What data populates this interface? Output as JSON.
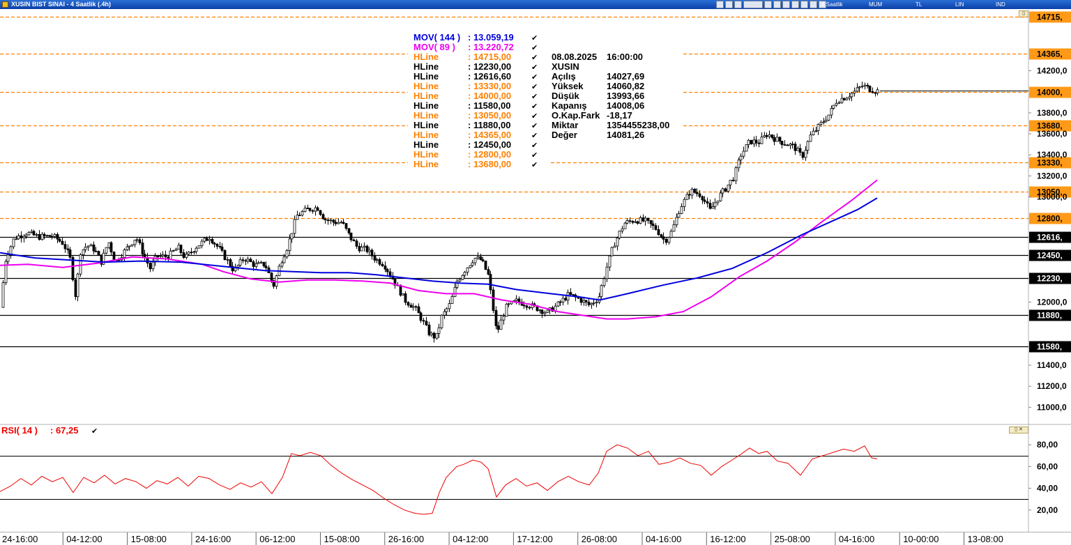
{
  "window": {
    "title": "XUSIN BIST SINAI - 4 Saatlik (.4h)",
    "toolbar": [
      "4 Saatlik",
      "MUM",
      "TL",
      "LIN",
      "IND"
    ]
  },
  "colors": {
    "candle": "#000000",
    "mov144": "#0000dd",
    "mov89": "#ee00ee",
    "hline_black": "#000000",
    "hline_orange": "#ff8000",
    "rsi": "#ee0000",
    "label_orange_bg": "#ff9a18",
    "label_black_bg": "#000000"
  },
  "legend": {
    "items": [
      {
        "name": "MOV( 144 )",
        "value": ": 13.059,19",
        "color": "#0000dd"
      },
      {
        "name": "MOV( 89 )",
        "value": ": 13.220,72",
        "color": "#ee00ee"
      },
      {
        "name": "HLine",
        "value": ": 14715,00",
        "color": "#ff8000"
      },
      {
        "name": "HLine",
        "value": ": 12230,00",
        "color": "#000000"
      },
      {
        "name": "HLine",
        "value": ": 12616,60",
        "color": "#000000"
      },
      {
        "name": "HLine",
        "value": ": 13330,00",
        "color": "#ff8000"
      },
      {
        "name": "HLine",
        "value": ": 14000,00",
        "color": "#ff8000"
      },
      {
        "name": "HLine",
        "value": ": 11580,00",
        "color": "#000000"
      },
      {
        "name": "HLine",
        "value": ": 13050,00",
        "color": "#ff8000"
      },
      {
        "name": "HLine",
        "value": ": 11880,00",
        "color": "#000000"
      },
      {
        "name": "HLine",
        "value": ": 14365,00",
        "color": "#ff8000"
      },
      {
        "name": "HLine",
        "value": ": 12450,00",
        "color": "#000000"
      },
      {
        "name": "HLine",
        "value": ": 12800,00",
        "color": "#ff8000"
      },
      {
        "name": "HLine",
        "value": ": 13680,00",
        "color": "#ff8000"
      }
    ],
    "check_mark": "✔"
  },
  "info": {
    "date": "08.08.2025",
    "time": "16:00:00",
    "symbol": "XUSIN",
    "rows": [
      {
        "label": "Açılış",
        "value": "14027,69"
      },
      {
        "label": "Yüksek",
        "value": "14060,82"
      },
      {
        "label": "Düşük",
        "value": "13993,66"
      },
      {
        "label": "Kapanış",
        "value": "14008,06"
      },
      {
        "label": "O.Kap.Fark",
        "value": "-18,17"
      },
      {
        "label": "Miktar",
        "value": "1354455238,00"
      },
      {
        "label": "Değer",
        "value": "14081,26"
      }
    ]
  },
  "rsi": {
    "label": "RSI( 14 )",
    "value": ": 67,25",
    "ticks": [
      {
        "v": 80,
        "label": "80,00"
      },
      {
        "v": 60,
        "label": "60,00"
      },
      {
        "v": 40,
        "label": "40,00"
      },
      {
        "v": 20,
        "label": "20,00"
      }
    ],
    "levels": [
      70,
      30
    ],
    "points": [
      [
        0,
        37
      ],
      [
        15,
        42
      ],
      [
        30,
        49
      ],
      [
        45,
        43
      ],
      [
        60,
        51
      ],
      [
        75,
        46
      ],
      [
        90,
        50
      ],
      [
        105,
        36
      ],
      [
        120,
        50
      ],
      [
        135,
        45
      ],
      [
        150,
        52
      ],
      [
        165,
        44
      ],
      [
        180,
        49
      ],
      [
        195,
        46
      ],
      [
        210,
        40
      ],
      [
        225,
        47
      ],
      [
        240,
        44
      ],
      [
        255,
        50
      ],
      [
        270,
        42
      ],
      [
        285,
        51
      ],
      [
        300,
        49
      ],
      [
        315,
        43
      ],
      [
        330,
        39
      ],
      [
        345,
        45
      ],
      [
        360,
        41
      ],
      [
        375,
        46
      ],
      [
        390,
        35
      ],
      [
        405,
        50
      ],
      [
        418,
        72
      ],
      [
        430,
        70
      ],
      [
        445,
        73
      ],
      [
        460,
        70
      ],
      [
        475,
        61
      ],
      [
        490,
        54
      ],
      [
        505,
        48
      ],
      [
        520,
        43
      ],
      [
        535,
        38
      ],
      [
        550,
        31
      ],
      [
        565,
        25
      ],
      [
        580,
        20
      ],
      [
        595,
        17
      ],
      [
        608,
        16
      ],
      [
        620,
        17
      ],
      [
        630,
        36
      ],
      [
        640,
        50
      ],
      [
        655,
        60
      ],
      [
        665,
        62
      ],
      [
        678,
        66
      ],
      [
        690,
        64
      ],
      [
        700,
        58
      ],
      [
        712,
        32
      ],
      [
        725,
        43
      ],
      [
        740,
        49
      ],
      [
        755,
        42
      ],
      [
        770,
        45
      ],
      [
        785,
        38
      ],
      [
        800,
        46
      ],
      [
        815,
        51
      ],
      [
        830,
        46
      ],
      [
        845,
        43
      ],
      [
        858,
        54
      ],
      [
        870,
        74
      ],
      [
        885,
        80
      ],
      [
        900,
        77
      ],
      [
        915,
        70
      ],
      [
        930,
        74
      ],
      [
        945,
        62
      ],
      [
        960,
        64
      ],
      [
        975,
        68
      ],
      [
        990,
        63
      ],
      [
        1005,
        61
      ],
      [
        1020,
        52
      ],
      [
        1035,
        60
      ],
      [
        1050,
        66
      ],
      [
        1062,
        71
      ],
      [
        1075,
        77
      ],
      [
        1088,
        72
      ],
      [
        1100,
        74
      ],
      [
        1115,
        65
      ],
      [
        1130,
        63
      ],
      [
        1148,
        52
      ],
      [
        1165,
        67
      ],
      [
        1180,
        70
      ],
      [
        1195,
        73
      ],
      [
        1210,
        76
      ],
      [
        1225,
        74
      ],
      [
        1240,
        79
      ],
      [
        1250,
        68
      ],
      [
        1258,
        67
      ]
    ]
  },
  "chart_data": [
    {
      "type": "candlestick",
      "y_axis": {
        "range": [
          10850,
          14780
        ],
        "ticks": [
          {
            "v": 14200,
            "label": "14200,0"
          },
          {
            "v": 13800,
            "label": "13800,0"
          },
          {
            "v": 13600,
            "label": "13600,0"
          },
          {
            "v": 13400,
            "label": "13400,0"
          },
          {
            "v": 13200,
            "label": "13200,0"
          },
          {
            "v": 13000,
            "label": "13000,0"
          },
          {
            "v": 12000,
            "label": "12000,0"
          },
          {
            "v": 11400,
            "label": "11400,0"
          },
          {
            "v": 11200,
            "label": "11200,0"
          },
          {
            "v": 11000,
            "label": "11000,0"
          }
        ]
      },
      "x_axis": {
        "ticks": [
          "24-16:00",
          "04-12:00",
          "15-08:00",
          "24-16:00",
          "06-12:00",
          "15-08:00",
          "26-16:00",
          "04-12:00",
          "17-12:00",
          "26-08:00",
          "04-16:00",
          "16-12:00",
          "25-08:00",
          "04-16:00",
          "10-00:00",
          "13-08:00"
        ]
      },
      "hlines": [
        {
          "value": 14715,
          "label": "14715,",
          "style": "dashed",
          "color": "orange"
        },
        {
          "value": 14365,
          "label": "14365,",
          "style": "dashed",
          "color": "orange"
        },
        {
          "value": 14000,
          "label": "14000,",
          "style": "dashed",
          "color": "orange"
        },
        {
          "value": 13680,
          "label": "13680,",
          "style": "dashed",
          "color": "orange"
        },
        {
          "value": 13330,
          "label": "13330,",
          "style": "dashed",
          "color": "orange"
        },
        {
          "value": 13050,
          "label": "13050,",
          "style": "dashed",
          "color": "orange"
        },
        {
          "value": 12800,
          "label": "12800,",
          "style": "dashed",
          "color": "orange"
        },
        {
          "value": 12616.6,
          "label": "12616,",
          "style": "solid",
          "color": "black"
        },
        {
          "value": 12450,
          "label": "12450,",
          "style": "solid",
          "color": "black"
        },
        {
          "value": 12230,
          "label": "12230,",
          "style": "solid",
          "color": "black"
        },
        {
          "value": 11880,
          "label": "11880,",
          "style": "solid",
          "color": "black"
        },
        {
          "value": 11580,
          "label": "11580,",
          "style": "solid",
          "color": "black"
        }
      ],
      "close_path": [
        [
          0,
          11950
        ],
        [
          8,
          12420
        ],
        [
          20,
          12610
        ],
        [
          38,
          12660
        ],
        [
          55,
          12620
        ],
        [
          75,
          12630
        ],
        [
          90,
          12560
        ],
        [
          100,
          12420
        ],
        [
          108,
          12050
        ],
        [
          115,
          12480
        ],
        [
          125,
          12540
        ],
        [
          135,
          12500
        ],
        [
          145,
          12380
        ],
        [
          155,
          12580
        ],
        [
          165,
          12380
        ],
        [
          180,
          12500
        ],
        [
          195,
          12620
        ],
        [
          205,
          12460
        ],
        [
          215,
          12320
        ],
        [
          225,
          12440
        ],
        [
          240,
          12430
        ],
        [
          255,
          12520
        ],
        [
          265,
          12420
        ],
        [
          280,
          12520
        ],
        [
          300,
          12620
        ],
        [
          315,
          12500
        ],
        [
          325,
          12400
        ],
        [
          335,
          12300
        ],
        [
          350,
          12420
        ],
        [
          365,
          12350
        ],
        [
          380,
          12360
        ],
        [
          392,
          12150
        ],
        [
          402,
          12380
        ],
        [
          412,
          12530
        ],
        [
          425,
          12820
        ],
        [
          440,
          12880
        ],
        [
          455,
          12900
        ],
        [
          465,
          12790
        ],
        [
          478,
          12760
        ],
        [
          490,
          12760
        ],
        [
          500,
          12640
        ],
        [
          512,
          12520
        ],
        [
          525,
          12500
        ],
        [
          538,
          12410
        ],
        [
          550,
          12360
        ],
        [
          565,
          12200
        ],
        [
          580,
          12020
        ],
        [
          595,
          11940
        ],
        [
          605,
          11830
        ],
        [
          615,
          11700
        ],
        [
          625,
          11660
        ],
        [
          633,
          11860
        ],
        [
          645,
          11980
        ],
        [
          655,
          12200
        ],
        [
          668,
          12320
        ],
        [
          680,
          12420
        ],
        [
          690,
          12400
        ],
        [
          700,
          12250
        ],
        [
          712,
          11700
        ],
        [
          725,
          11950
        ],
        [
          740,
          12010
        ],
        [
          755,
          11980
        ],
        [
          770,
          11940
        ],
        [
          785,
          11900
        ],
        [
          800,
          11980
        ],
        [
          815,
          12070
        ],
        [
          830,
          12030
        ],
        [
          845,
          11970
        ],
        [
          858,
          12040
        ],
        [
          870,
          12340
        ],
        [
          880,
          12550
        ],
        [
          895,
          12750
        ],
        [
          910,
          12780
        ],
        [
          925,
          12770
        ],
        [
          940,
          12700
        ],
        [
          953,
          12580
        ],
        [
          963,
          12670
        ],
        [
          975,
          12900
        ],
        [
          990,
          13060
        ],
        [
          1005,
          13020
        ],
        [
          1018,
          12870
        ],
        [
          1030,
          13000
        ],
        [
          1040,
          13080
        ],
        [
          1052,
          13190
        ],
        [
          1062,
          13400
        ],
        [
          1075,
          13530
        ],
        [
          1088,
          13520
        ],
        [
          1100,
          13600
        ],
        [
          1112,
          13550
        ],
        [
          1125,
          13510
        ],
        [
          1138,
          13480
        ],
        [
          1150,
          13380
        ],
        [
          1162,
          13580
        ],
        [
          1175,
          13680
        ],
        [
          1188,
          13780
        ],
        [
          1200,
          13920
        ],
        [
          1212,
          13950
        ],
        [
          1225,
          14000
        ],
        [
          1237,
          14060
        ],
        [
          1246,
          14030
        ],
        [
          1252,
          14015
        ],
        [
          1260,
          14008
        ]
      ],
      "mov144": [
        [
          0,
          12470
        ],
        [
          50,
          12420
        ],
        [
          100,
          12400
        ],
        [
          150,
          12380
        ],
        [
          200,
          12390
        ],
        [
          260,
          12380
        ],
        [
          320,
          12340
        ],
        [
          380,
          12300
        ],
        [
          420,
          12290
        ],
        [
          460,
          12280
        ],
        [
          500,
          12280
        ],
        [
          540,
          12260
        ],
        [
          580,
          12230
        ],
        [
          620,
          12200
        ],
        [
          660,
          12180
        ],
        [
          700,
          12170
        ],
        [
          740,
          12120
        ],
        [
          790,
          12080
        ],
        [
          830,
          12050
        ],
        [
          860,
          12020
        ],
        [
          900,
          12080
        ],
        [
          950,
          12160
        ],
        [
          1000,
          12230
        ],
        [
          1050,
          12320
        ],
        [
          1100,
          12470
        ],
        [
          1150,
          12640
        ],
        [
          1200,
          12790
        ],
        [
          1230,
          12880
        ],
        [
          1258,
          12990
        ]
      ],
      "mov89": [
        [
          0,
          12350
        ],
        [
          40,
          12360
        ],
        [
          90,
          12330
        ],
        [
          140,
          12370
        ],
        [
          190,
          12430
        ],
        [
          240,
          12410
        ],
        [
          290,
          12360
        ],
        [
          320,
          12290
        ],
        [
          360,
          12220
        ],
        [
          400,
          12190
        ],
        [
          440,
          12210
        ],
        [
          480,
          12210
        ],
        [
          520,
          12200
        ],
        [
          560,
          12180
        ],
        [
          600,
          12110
        ],
        [
          640,
          12080
        ],
        [
          680,
          12080
        ],
        [
          720,
          12020
        ],
        [
          760,
          11980
        ],
        [
          800,
          11910
        ],
        [
          840,
          11870
        ],
        [
          870,
          11840
        ],
        [
          900,
          11840
        ],
        [
          940,
          11860
        ],
        [
          980,
          11910
        ],
        [
          1020,
          12050
        ],
        [
          1060,
          12240
        ],
        [
          1100,
          12390
        ],
        [
          1140,
          12570
        ],
        [
          1180,
          12770
        ],
        [
          1220,
          12960
        ],
        [
          1258,
          13160
        ]
      ]
    }
  ]
}
